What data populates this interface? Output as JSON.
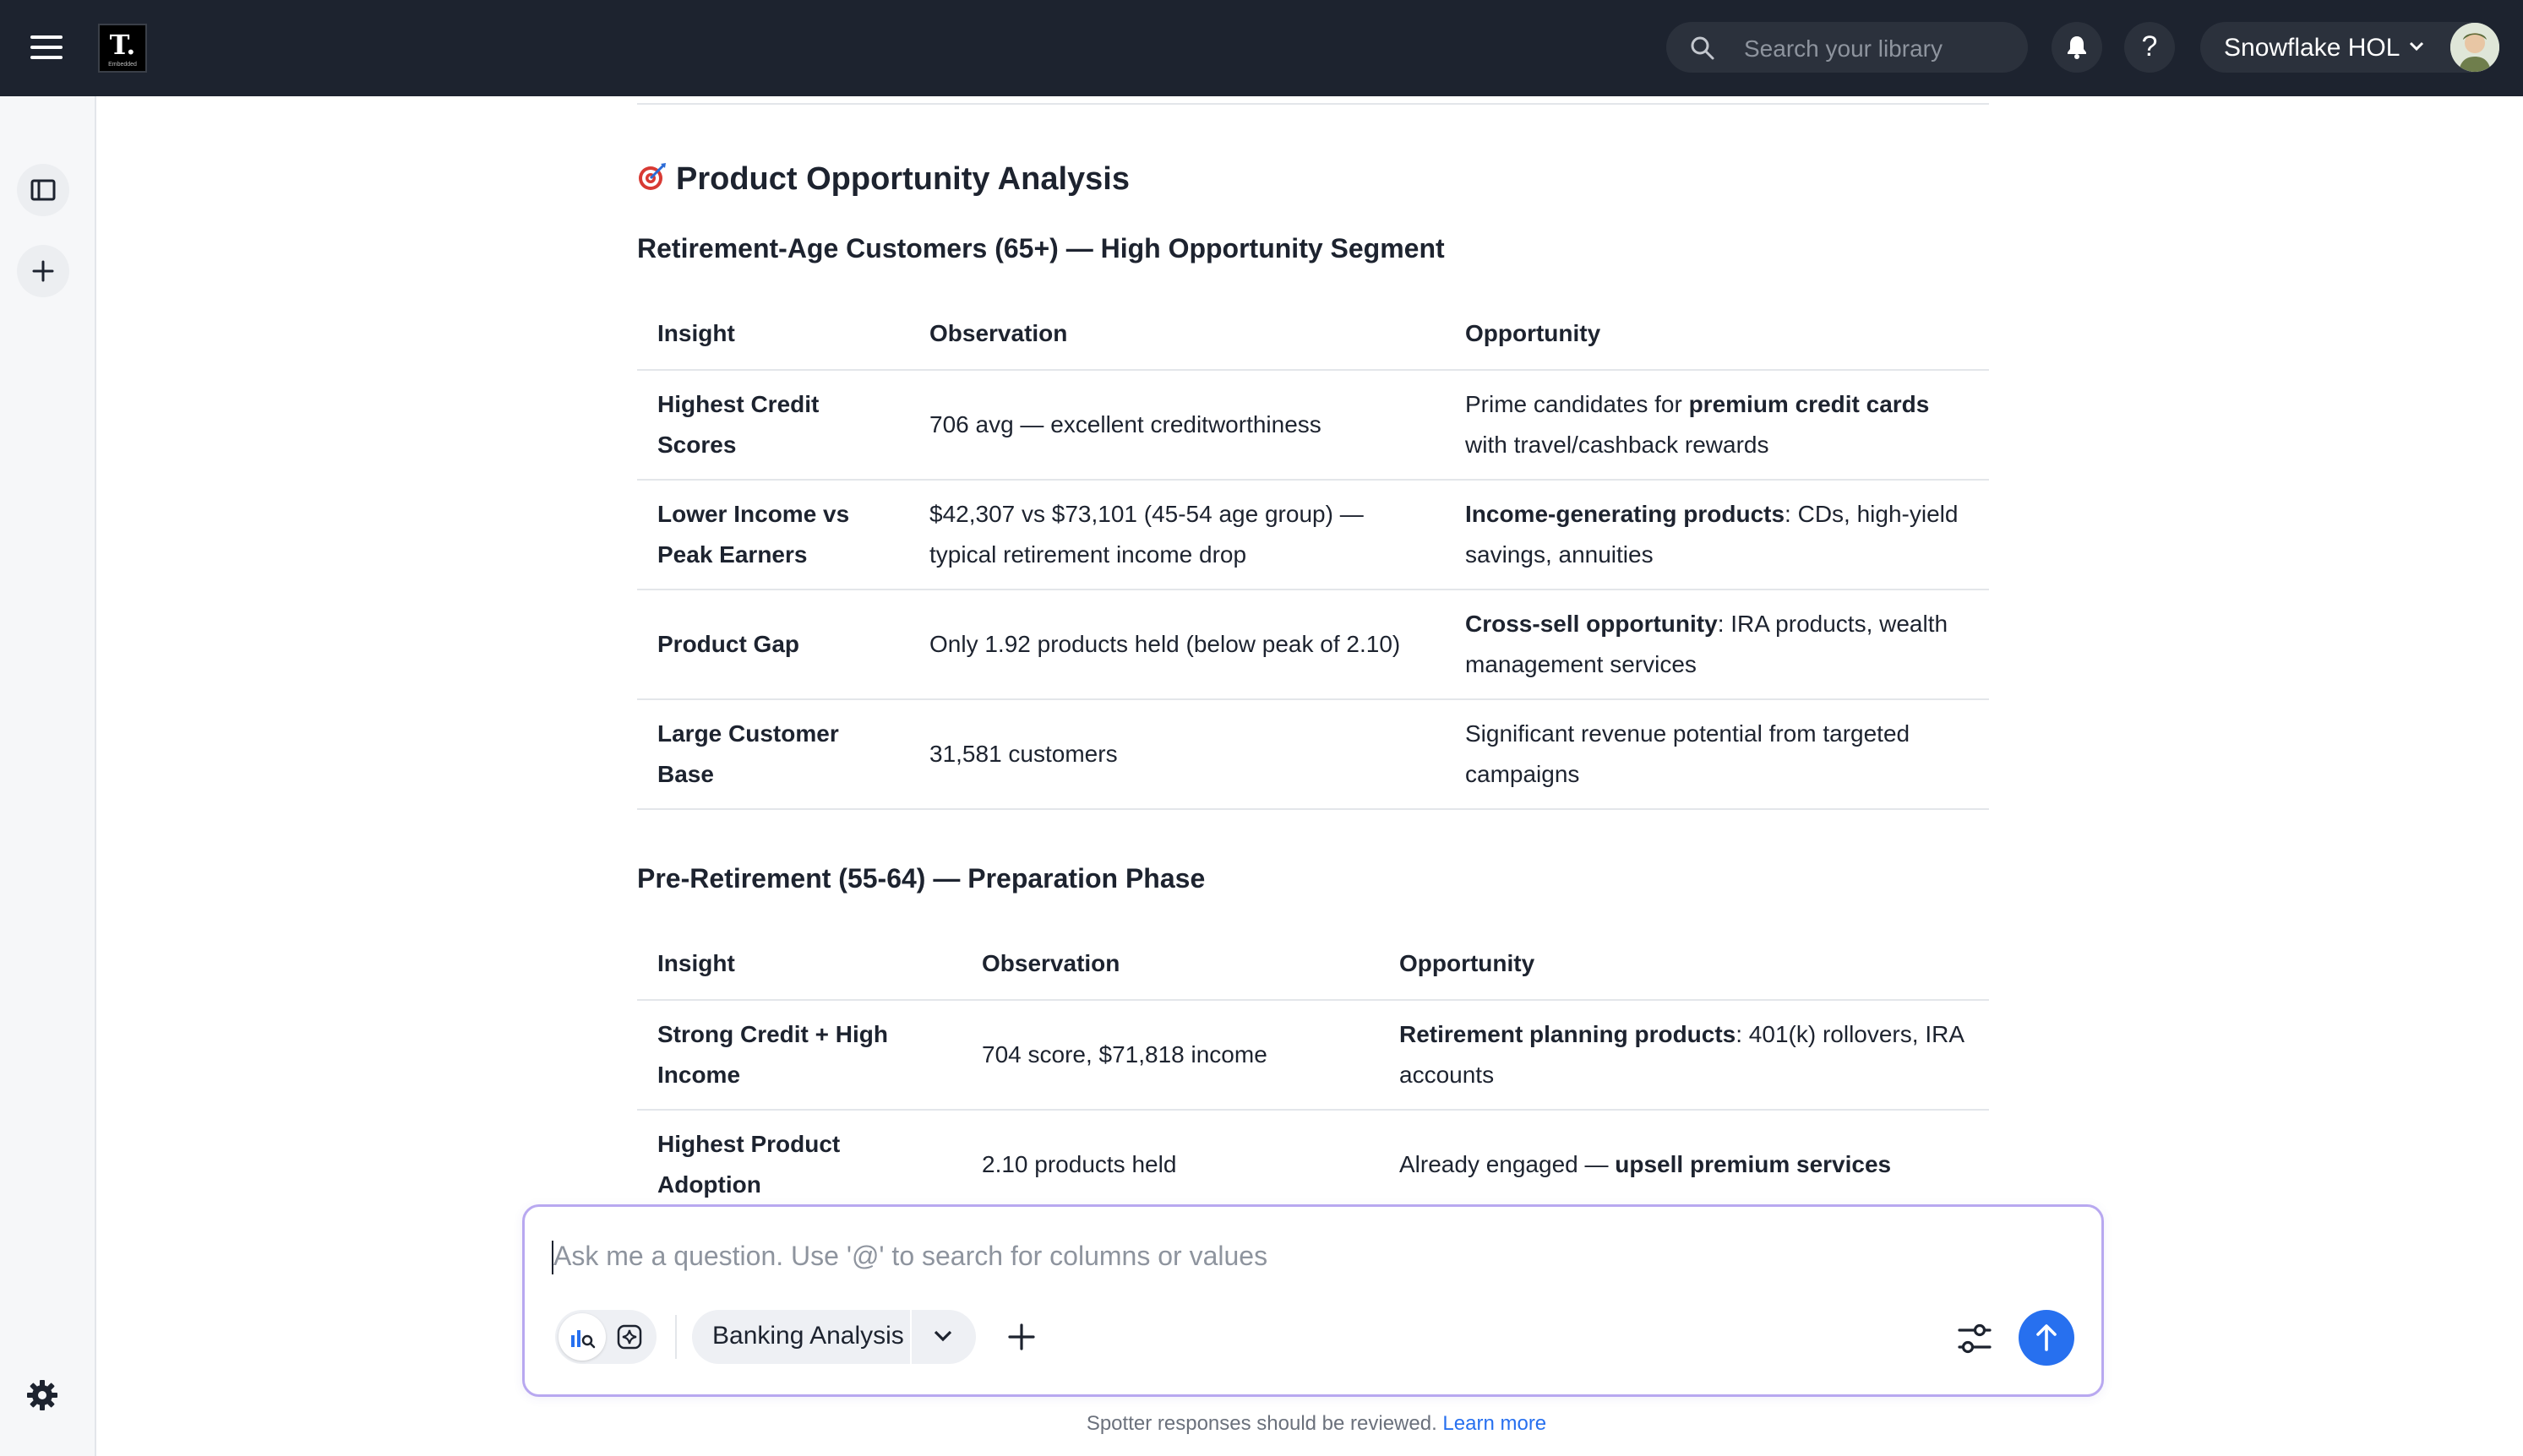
{
  "header": {
    "logo_text": "T.",
    "logo_subtext": "Embedded",
    "search_placeholder": "Search your library",
    "help_label": "?",
    "org_name": "Snowflake HOL"
  },
  "content": {
    "section_title": "Product Opportunity Analysis",
    "section_icon": "target-dart-icon",
    "tables": [
      {
        "heading": "Retirement-Age Customers (65+) — High Opportunity Segment",
        "columns": [
          "Insight",
          "Observation",
          "Opportunity"
        ],
        "rows": [
          {
            "insight": "Highest Credit Scores",
            "observation": "706 avg — excellent creditworthiness",
            "opportunity_pre": "Prime candidates for ",
            "opportunity_bold": "premium credit cards",
            "opportunity_post": " with travel/cashback rewards"
          },
          {
            "insight": "Lower Income vs Peak Earners",
            "observation": "$42,307 vs $73,101 (45-54 age group) — typical retirement income drop",
            "opportunity_pre": "",
            "opportunity_bold": "Income-generating products",
            "opportunity_post": ": CDs, high-yield savings, annuities"
          },
          {
            "insight": "Product Gap",
            "observation": "Only 1.92 products held (below peak of 2.10)",
            "opportunity_pre": "",
            "opportunity_bold": "Cross-sell opportunity",
            "opportunity_post": ": IRA products, wealth management services"
          },
          {
            "insight": "Large Customer Base",
            "observation": "31,581 customers",
            "opportunity_pre": "Significant revenue potential from targeted campaigns",
            "opportunity_bold": "",
            "opportunity_post": ""
          }
        ]
      },
      {
        "heading": "Pre-Retirement (55-64) — Preparation Phase",
        "columns": [
          "Insight",
          "Observation",
          "Opportunity"
        ],
        "rows": [
          {
            "insight": "Strong Credit + High Income",
            "observation": "704 score, $71,818 income",
            "opportunity_pre": "",
            "opportunity_bold": "Retirement planning products",
            "opportunity_post": ": 401(k) rollovers, IRA accounts"
          },
          {
            "insight": "Highest Product Adoption",
            "observation": "2.10 products held",
            "opportunity_pre": "Already engaged — ",
            "opportunity_bold": "upsell premium services",
            "opportunity_post": ""
          }
        ]
      }
    ]
  },
  "chat": {
    "placeholder": "Ask me a question. Use '@' to search for columns or values",
    "data_source": "Banking Analysis"
  },
  "footer": {
    "disclaimer": "Spotter responses should be reviewed.",
    "learn_more": "Learn more"
  },
  "colors": {
    "topbar": "#1d232f",
    "accent": "#2770ef",
    "input_border": "#b8a8f0"
  }
}
